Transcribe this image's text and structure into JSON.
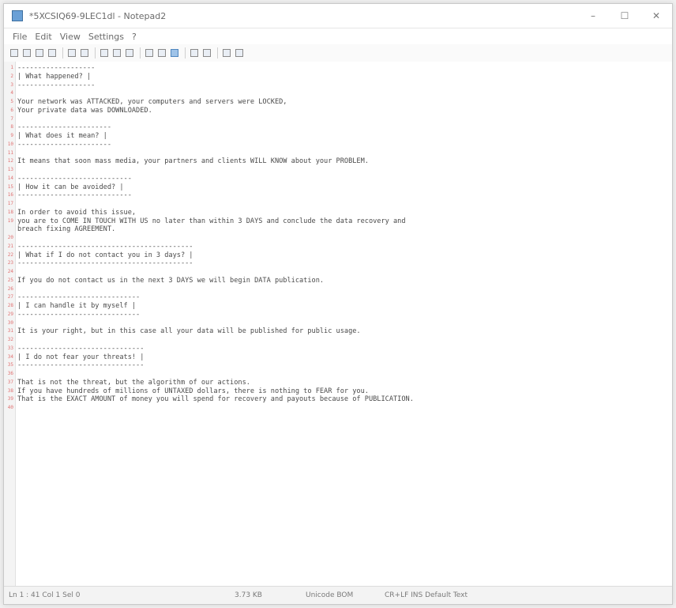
{
  "window": {
    "title": "*5XCSIQ69-9LEC1dl - Notepad2",
    "controls": {
      "minimize": "–",
      "maximize": "☐",
      "close": "✕"
    }
  },
  "menu": [
    "File",
    "Edit",
    "View",
    "Settings",
    "?"
  ],
  "toolbar": {
    "buttons": [
      "new",
      "open",
      "save",
      "save-as",
      "undo",
      "redo",
      "cut",
      "copy",
      "paste",
      "find",
      "replace",
      "wrap",
      "zoom-in",
      "zoom-out",
      "scheme",
      "settings"
    ]
  },
  "editor": {
    "lines": [
      {
        "n": "1",
        "text": "-------------------"
      },
      {
        "n": "2",
        "text": "| What happened? |"
      },
      {
        "n": "3",
        "text": "-------------------"
      },
      {
        "n": "4",
        "text": ""
      },
      {
        "n": "5",
        "text": "Your network was ATTACKED, your computers and servers were LOCKED,"
      },
      {
        "n": "6",
        "text": "Your private data was DOWNLOADED."
      },
      {
        "n": "7",
        "text": ""
      },
      {
        "n": "8",
        "text": "-----------------------"
      },
      {
        "n": "9",
        "text": "| What does it mean? |"
      },
      {
        "n": "10",
        "text": "-----------------------"
      },
      {
        "n": "11",
        "text": ""
      },
      {
        "n": "12",
        "text": "It means that soon mass media, your partners and clients WILL KNOW about your PROBLEM."
      },
      {
        "n": "13",
        "text": ""
      },
      {
        "n": "14",
        "text": "----------------------------"
      },
      {
        "n": "15",
        "text": "| How it can be avoided? |"
      },
      {
        "n": "16",
        "text": "----------------------------"
      },
      {
        "n": "17",
        "text": ""
      },
      {
        "n": "18",
        "text": "In order to avoid this issue,"
      },
      {
        "n": "19",
        "text": "you are to COME IN TOUCH WITH US no later than within 3 DAYS and conclude the data recovery and"
      },
      {
        "n": "",
        "text": "breach fixing AGREEMENT."
      },
      {
        "n": "20",
        "text": ""
      },
      {
        "n": "21",
        "text": "-------------------------------------------"
      },
      {
        "n": "22",
        "text": "| What if I do not contact you in 3 days? |"
      },
      {
        "n": "23",
        "text": "-------------------------------------------"
      },
      {
        "n": "24",
        "text": ""
      },
      {
        "n": "25",
        "text": "If you do not contact us in the next 3 DAYS we will begin DATA publication."
      },
      {
        "n": "26",
        "text": ""
      },
      {
        "n": "27",
        "text": "------------------------------"
      },
      {
        "n": "28",
        "text": "| I can handle it by myself |"
      },
      {
        "n": "29",
        "text": "------------------------------"
      },
      {
        "n": "30",
        "text": ""
      },
      {
        "n": "31",
        "text": "It is your right, but in this case all your data will be published for public usage."
      },
      {
        "n": "32",
        "text": ""
      },
      {
        "n": "33",
        "text": "-------------------------------"
      },
      {
        "n": "34",
        "text": "| I do not fear your threats! |"
      },
      {
        "n": "35",
        "text": "-------------------------------"
      },
      {
        "n": "36",
        "text": ""
      },
      {
        "n": "37",
        "text": "That is not the threat, but the algorithm of our actions."
      },
      {
        "n": "38",
        "text": "If you have hundreds of millions of UNTAXED dollars, there is nothing to FEAR for you."
      },
      {
        "n": "39",
        "text": "That is the EXACT AMOUNT of money you will spend for recovery and payouts because of PUBLICATION."
      },
      {
        "n": "40",
        "text": ""
      }
    ]
  },
  "status": {
    "position": "Ln 1 : 41   Col 1   Sel 0",
    "size": "3.73 KB",
    "encoding": "Unicode BOM",
    "line_endings": "CR+LF   INS   Default Text"
  }
}
